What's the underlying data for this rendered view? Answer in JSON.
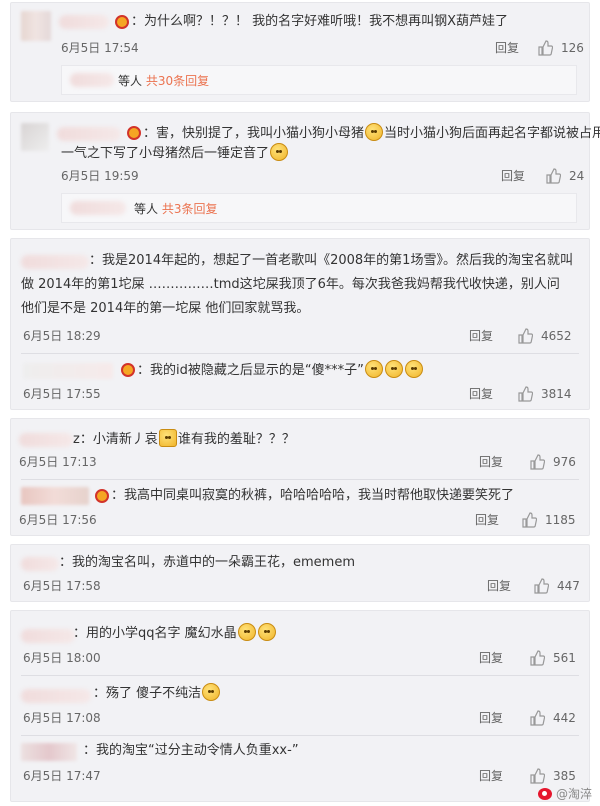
{
  "comments": [
    {
      "text": "：为什么啊？！？！ 我的名字好难听哦！我不想再叫钢X葫芦娃了",
      "time": "6月5日 17:54",
      "reply": "回复",
      "likes": "126",
      "sub_prefix": "等人",
      "sub_count": "共30条回复"
    },
    {
      "line1a": "：害，快别提了，我叫小猫小狗小母猪",
      "line1b": "当时小猫小狗后面再起名字都说被占用，",
      "line2": "一气之下写了小母猪然后一锤定音了",
      "time": "6月5日 19:59",
      "reply": "回复",
      "likes": "24",
      "sub_prefix": "等人",
      "sub_count": "共3条回复"
    },
    {
      "line1": "：我是2014年起的，想起了一首老歌叫《2008年的第1场雪》。然后我的淘宝名就叫",
      "line2": "做  2014年的第1坨屎  ……………tmd这坨屎我顶了6年。每次我爸我妈帮我代收快递，别人问",
      "line3": "他们是不是  2014年的第一坨屎   他们回家就骂我。",
      "time": "6月5日 18:29",
      "reply": "回复",
      "likes": "4652"
    },
    {
      "text": "：我的id被隐藏之后显示的是“傻***子”",
      "time": "6月5日 17:55",
      "reply": "回复",
      "likes": "3814"
    },
    {
      "prefix": "z",
      "text": "：小清新丿哀",
      "text_after": "谁有我的羞耻？？？",
      "time": "6月5日 17:13",
      "reply": "回复",
      "likes": "976"
    },
    {
      "text": "：我高中同桌叫寂寞的秋裤，哈哈哈哈哈，我当时帮他取快递要笑死了",
      "time": "6月5日 17:56",
      "reply": "回复",
      "likes": "1185"
    },
    {
      "text": "：我的淘宝名叫，赤道中的一朵霸王花，ememem",
      "time": "6月5日 17:58",
      "reply": "回复",
      "likes": "447"
    },
    {
      "text": "：用的小学qq名字 魔幻水晶",
      "time": "6月5日 18:00",
      "reply": "回复",
      "likes": "561"
    },
    {
      "text": "：殇了 傻子不纯洁",
      "time": "6月5日 17:08",
      "reply": "回复",
      "likes": "442"
    },
    {
      "text": "：我的淘宝“过分主动令情人负重xx-”",
      "time": "6月5日 17:47",
      "reply": "回复",
      "likes": "385"
    }
  ],
  "watermark": "@淘淬",
  "colors": {
    "accent": "#eb7350",
    "card_bg": "#f2f2f5"
  }
}
